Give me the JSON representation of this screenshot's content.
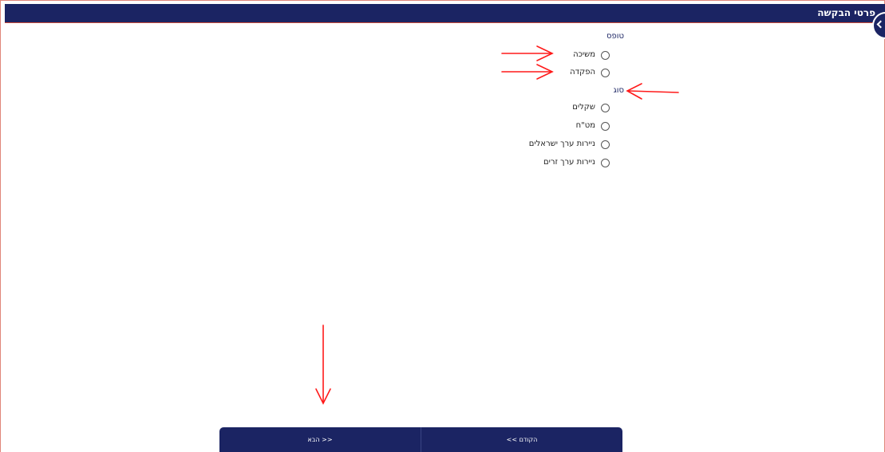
{
  "header": {
    "title": "פרטי הבקשה"
  },
  "form": {
    "section_type": {
      "title": "טופס",
      "options": [
        {
          "label": "משיכה"
        },
        {
          "label": "הפקדה"
        }
      ]
    },
    "section_kind": {
      "title": "סוג",
      "options": [
        {
          "label": "שקלים"
        },
        {
          "label": "מט\"ח"
        },
        {
          "label": "ניירות ערך ישראלים"
        },
        {
          "label": "ניירות ערך זרים"
        }
      ]
    }
  },
  "navigation": {
    "next_label": "הבא >>",
    "prev_label": "<< הקודם"
  },
  "colors": {
    "primary": "#1b2463",
    "annotation": "#ff1a1a"
  }
}
